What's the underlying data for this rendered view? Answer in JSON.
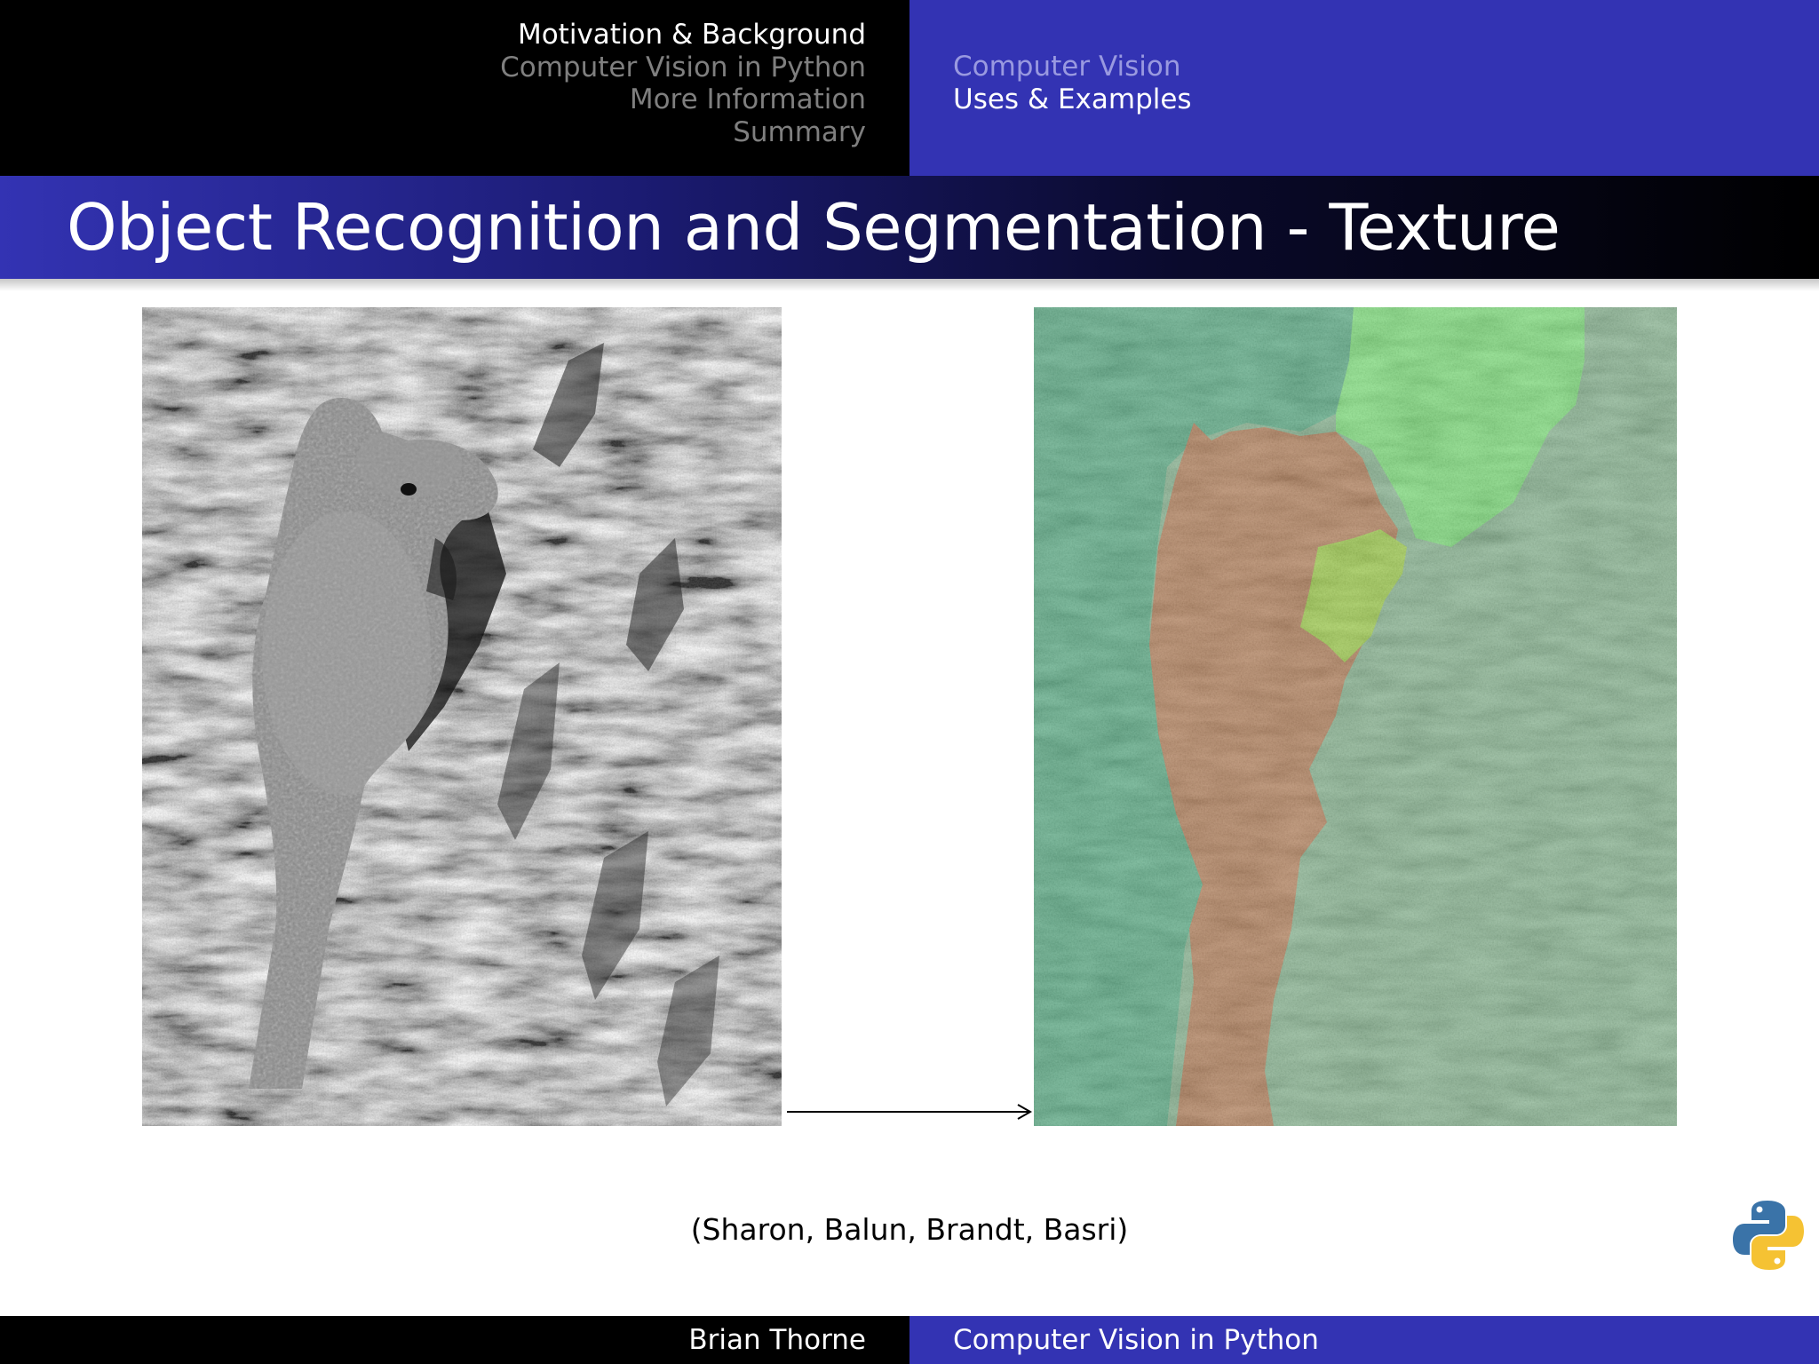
{
  "header": {
    "sections": [
      {
        "label": "Motivation & Background",
        "active": true
      },
      {
        "label": "Computer Vision in Python",
        "active": false
      },
      {
        "label": "More Information",
        "active": false
      },
      {
        "label": "Summary",
        "active": false
      }
    ],
    "subsections": [
      {
        "label": "Computer Vision",
        "active": false
      },
      {
        "label": "Uses & Examples",
        "active": true
      }
    ]
  },
  "slide": {
    "title": "Object Recognition and Segmentation - Texture",
    "citation": "(Sharon, Balun, Brandt, Basri)"
  },
  "figures": {
    "original": {
      "icon": "grayscale-squirrel-on-bark-photo"
    },
    "segmented": {
      "icon": "texture-segmentation-result-image"
    },
    "arrow": {
      "icon": "right-arrow-icon"
    }
  },
  "logo": {
    "icon": "python-logo-icon",
    "colors": [
      "#3a73a8",
      "#f5c233"
    ]
  },
  "footer": {
    "author": "Brian Thorne",
    "talk_title": "Computer Vision in Python"
  },
  "colors": {
    "header_left": "#000000",
    "header_right": "#3333b3",
    "segment_dark_green": "#2e9e68",
    "segment_light_green": "#5ee45a",
    "segment_yellow_green": "#8ccc1a",
    "segment_brown": "#a8622e",
    "segment_sage": "#6caa78"
  }
}
